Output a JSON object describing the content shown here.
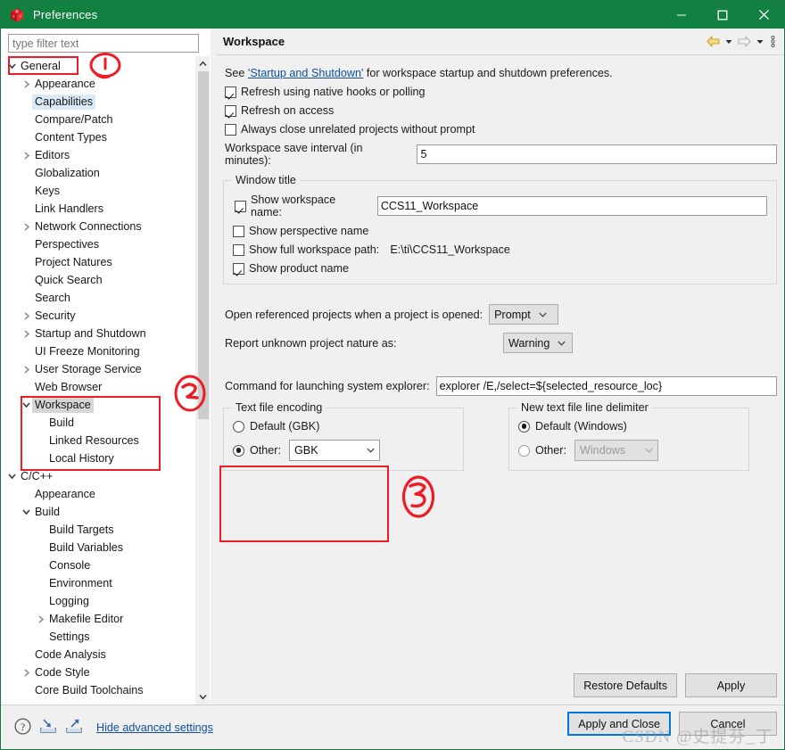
{
  "window": {
    "title": "Preferences",
    "icon": "ccs-cube-icon",
    "accent_green": "#128040",
    "controls": {
      "minimize": "minimize-icon",
      "maximize": "maximize-icon",
      "close": "close-icon"
    }
  },
  "sidebar": {
    "filter_placeholder": "type filter text",
    "tree": [
      {
        "label": "General",
        "indent": 0,
        "twisty": "down",
        "state": "none"
      },
      {
        "label": "Appearance",
        "indent": 1,
        "twisty": "right",
        "state": "none"
      },
      {
        "label": "Capabilities",
        "indent": 1,
        "twisty": "none",
        "state": "selected"
      },
      {
        "label": "Compare/Patch",
        "indent": 1,
        "twisty": "none",
        "state": "none"
      },
      {
        "label": "Content Types",
        "indent": 1,
        "twisty": "none",
        "state": "none"
      },
      {
        "label": "Editors",
        "indent": 1,
        "twisty": "right",
        "state": "none"
      },
      {
        "label": "Globalization",
        "indent": 1,
        "twisty": "none",
        "state": "none"
      },
      {
        "label": "Keys",
        "indent": 1,
        "twisty": "none",
        "state": "none"
      },
      {
        "label": "Link Handlers",
        "indent": 1,
        "twisty": "none",
        "state": "none"
      },
      {
        "label": "Network Connections",
        "indent": 1,
        "twisty": "right",
        "state": "none"
      },
      {
        "label": "Perspectives",
        "indent": 1,
        "twisty": "none",
        "state": "none"
      },
      {
        "label": "Project Natures",
        "indent": 1,
        "twisty": "none",
        "state": "none"
      },
      {
        "label": "Quick Search",
        "indent": 1,
        "twisty": "none",
        "state": "none"
      },
      {
        "label": "Search",
        "indent": 1,
        "twisty": "none",
        "state": "none"
      },
      {
        "label": "Security",
        "indent": 1,
        "twisty": "right",
        "state": "none"
      },
      {
        "label": "Startup and Shutdown",
        "indent": 1,
        "twisty": "right",
        "state": "none"
      },
      {
        "label": "UI Freeze Monitoring",
        "indent": 1,
        "twisty": "none",
        "state": "none"
      },
      {
        "label": "User Storage Service",
        "indent": 1,
        "twisty": "right",
        "state": "none"
      },
      {
        "label": "Web Browser",
        "indent": 1,
        "twisty": "none",
        "state": "none"
      },
      {
        "label": "Workspace",
        "indent": 1,
        "twisty": "down",
        "state": "current"
      },
      {
        "label": "Build",
        "indent": 2,
        "twisty": "none",
        "state": "none"
      },
      {
        "label": "Linked Resources",
        "indent": 2,
        "twisty": "none",
        "state": "none"
      },
      {
        "label": "Local History",
        "indent": 2,
        "twisty": "none",
        "state": "none"
      },
      {
        "label": "C/C++",
        "indent": 0,
        "twisty": "down",
        "state": "none"
      },
      {
        "label": "Appearance",
        "indent": 1,
        "twisty": "none",
        "state": "none"
      },
      {
        "label": "Build",
        "indent": 1,
        "twisty": "down",
        "state": "none"
      },
      {
        "label": "Build Targets",
        "indent": 2,
        "twisty": "none",
        "state": "none"
      },
      {
        "label": "Build Variables",
        "indent": 2,
        "twisty": "none",
        "state": "none"
      },
      {
        "label": "Console",
        "indent": 2,
        "twisty": "none",
        "state": "none"
      },
      {
        "label": "Environment",
        "indent": 2,
        "twisty": "none",
        "state": "none"
      },
      {
        "label": "Logging",
        "indent": 2,
        "twisty": "none",
        "state": "none"
      },
      {
        "label": "Makefile Editor",
        "indent": 2,
        "twisty": "right",
        "state": "none"
      },
      {
        "label": "Settings",
        "indent": 2,
        "twisty": "none",
        "state": "none"
      },
      {
        "label": "Code Analysis",
        "indent": 1,
        "twisty": "none",
        "state": "none"
      },
      {
        "label": "Code Style",
        "indent": 1,
        "twisty": "right",
        "state": "none"
      },
      {
        "label": "Core Build Toolchains",
        "indent": 1,
        "twisty": "none",
        "state": "none"
      }
    ]
  },
  "page": {
    "title": "Workspace",
    "nav": {
      "back": "back-arrow-icon",
      "forward": "forward-arrow-icon",
      "menu": "view-menu-icon"
    },
    "description": {
      "prefix": "See ",
      "link": "'Startup and Shutdown'",
      "suffix": " for workspace startup and shutdown preferences."
    },
    "checkboxes": [
      {
        "label": "Refresh using native hooks or polling",
        "checked": true
      },
      {
        "label": "Refresh on access",
        "checked": true
      },
      {
        "label": "Always close unrelated projects without prompt",
        "checked": false
      }
    ],
    "save_interval": {
      "label": "Workspace save interval (in minutes):",
      "value": "5"
    },
    "window_title_group": {
      "legend": "Window title",
      "show_workspace_name": {
        "label": "Show workspace name:",
        "checked": true,
        "value": "CCS11_Workspace"
      },
      "show_perspective_name": {
        "label": "Show perspective name",
        "checked": false
      },
      "show_full_workspace_path": {
        "label": "Show full workspace path:",
        "checked": false,
        "value": "E:\\ti\\CCS11_Workspace"
      },
      "show_product_name": {
        "label": "Show product name",
        "checked": true
      }
    },
    "open_referenced": {
      "label": "Open referenced projects when a project is opened:",
      "value": "Prompt"
    },
    "report_nature": {
      "label": "Report unknown project nature as:",
      "value": "Warning"
    },
    "explorer_command": {
      "label": "Command for launching system explorer:",
      "value": "explorer /E,/select=${selected_resource_loc}"
    },
    "text_file_encoding": {
      "legend": "Text file encoding",
      "default_label": "Default (GBK)",
      "default_selected": false,
      "other_label": "Other:",
      "other_selected": true,
      "other_value": "GBK"
    },
    "line_delimiter": {
      "legend": "New text file line delimiter",
      "default_label": "Default (Windows)",
      "default_selected": true,
      "other_label": "Other:",
      "other_selected": false,
      "other_value": "Windows"
    },
    "restore_defaults": "Restore Defaults",
    "apply": "Apply"
  },
  "footer": {
    "help_icon": "help-icon",
    "import_icon": "import-icon",
    "export_icon": "export-icon",
    "advanced_link": "Hide advanced settings",
    "apply_and_close": "Apply and Close",
    "cancel": "Cancel"
  },
  "annotations": {
    "marker_1": "1",
    "marker_2": "2",
    "marker_3": "3",
    "color": "#ee1c25"
  },
  "watermark": "CSDN @史提芬_丁"
}
